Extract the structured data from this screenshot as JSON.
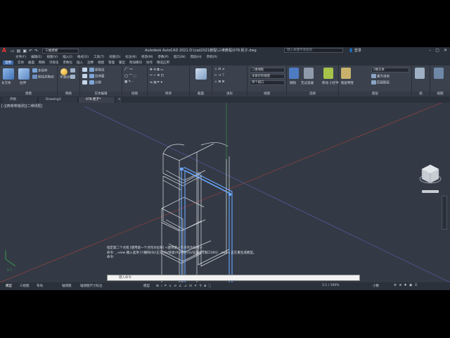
{
  "titlebar": {
    "workspace": "三维建模",
    "app_title": "Autodesk AutoCAD 2021    D:\\cad2021教程\\三维教程\\078.柜子.dwg",
    "search_placeholder": "键入关键字或短语",
    "user": "登录"
  },
  "menu": [
    "文件(F)",
    "编辑(E)",
    "视图(V)",
    "插入(I)",
    "格式(O)",
    "工具(T)",
    "绘图(D)",
    "标注(N)",
    "修改(M)",
    "参数(P)",
    "窗口(W)",
    "帮助(H)",
    "参照(R)"
  ],
  "ribbon_tabs": [
    "常用",
    "实体",
    "曲面",
    "网格",
    "可视化",
    "参数化",
    "插入",
    "注释",
    "视图",
    "管理",
    "输出",
    "附加模块",
    "协作",
    "精选应用"
  ],
  "panels": {
    "modeling": {
      "title": "建模",
      "box": "长方体",
      "extrude": "拉伸",
      "smooth_object": "平滑对象"
    },
    "mesh": {
      "title": "网格"
    },
    "solid_edit": {
      "title": "实体编辑",
      "extract_edges": "提取边",
      "extrude_faces": "拉伸面",
      "separate": "分割"
    },
    "draw": {
      "title": "绘图"
    },
    "modify": {
      "title": "修改"
    },
    "section": {
      "title": "截面"
    },
    "coordinates": {
      "title": "坐标"
    },
    "view": {
      "title": "视图",
      "visual_style": "二维线框",
      "unsaved_view": "未保存的视图",
      "viewport": "单个视口"
    },
    "selection": {
      "title": "选择",
      "filter": "无过滤器"
    },
    "layers": {
      "title": "图层",
      "current": "2维实体"
    },
    "groups": {
      "title": "组"
    },
    "view2": {
      "title": "视图"
    }
  },
  "doc_tabs": [
    "开始",
    "Drawing3",
    "078.柜子*"
  ],
  "viewport_label": "[-][西南等轴测][二维线框]",
  "command_history": [
    "指定第二个点或 [使用第一个点作为位移] <使用第一个点作为位移>:",
    "命令: _-view 输入选项 [?/删除(D)/正交(O)/恢复(R)/保存(S)/设置(E)/窗口(W)]: _swiso 正在重生成模型。",
    "命令:"
  ],
  "command_placeholder": "键入命令",
  "layout_tabs": [
    "模型",
    "三视图",
    "布局",
    "轴测图",
    "轴测图尺寸标注"
  ],
  "status": {
    "model": "模型",
    "scale": "1:1 / 100%",
    "units": "小数"
  },
  "colors": {
    "background": "#333a45",
    "accent": "#3c6bb0",
    "wire": "#d9dde2",
    "selected": "#6aa6ff"
  }
}
